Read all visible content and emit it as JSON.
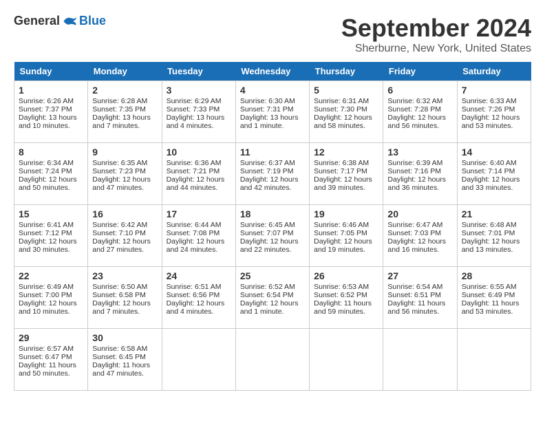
{
  "logo": {
    "general": "General",
    "blue": "Blue"
  },
  "title": "September 2024",
  "subtitle": "Sherburne, New York, United States",
  "days_of_week": [
    "Sunday",
    "Monday",
    "Tuesday",
    "Wednesday",
    "Thursday",
    "Friday",
    "Saturday"
  ],
  "weeks": [
    [
      {
        "day": "1",
        "info": "Sunrise: 6:26 AM\nSunset: 7:37 PM\nDaylight: 13 hours and 10 minutes."
      },
      {
        "day": "2",
        "info": "Sunrise: 6:28 AM\nSunset: 7:35 PM\nDaylight: 13 hours and 7 minutes."
      },
      {
        "day": "3",
        "info": "Sunrise: 6:29 AM\nSunset: 7:33 PM\nDaylight: 13 hours and 4 minutes."
      },
      {
        "day": "4",
        "info": "Sunrise: 6:30 AM\nSunset: 7:31 PM\nDaylight: 13 hours and 1 minute."
      },
      {
        "day": "5",
        "info": "Sunrise: 6:31 AM\nSunset: 7:30 PM\nDaylight: 12 hours and 58 minutes."
      },
      {
        "day": "6",
        "info": "Sunrise: 6:32 AM\nSunset: 7:28 PM\nDaylight: 12 hours and 56 minutes."
      },
      {
        "day": "7",
        "info": "Sunrise: 6:33 AM\nSunset: 7:26 PM\nDaylight: 12 hours and 53 minutes."
      }
    ],
    [
      {
        "day": "8",
        "info": "Sunrise: 6:34 AM\nSunset: 7:24 PM\nDaylight: 12 hours and 50 minutes."
      },
      {
        "day": "9",
        "info": "Sunrise: 6:35 AM\nSunset: 7:23 PM\nDaylight: 12 hours and 47 minutes."
      },
      {
        "day": "10",
        "info": "Sunrise: 6:36 AM\nSunset: 7:21 PM\nDaylight: 12 hours and 44 minutes."
      },
      {
        "day": "11",
        "info": "Sunrise: 6:37 AM\nSunset: 7:19 PM\nDaylight: 12 hours and 42 minutes."
      },
      {
        "day": "12",
        "info": "Sunrise: 6:38 AM\nSunset: 7:17 PM\nDaylight: 12 hours and 39 minutes."
      },
      {
        "day": "13",
        "info": "Sunrise: 6:39 AM\nSunset: 7:16 PM\nDaylight: 12 hours and 36 minutes."
      },
      {
        "day": "14",
        "info": "Sunrise: 6:40 AM\nSunset: 7:14 PM\nDaylight: 12 hours and 33 minutes."
      }
    ],
    [
      {
        "day": "15",
        "info": "Sunrise: 6:41 AM\nSunset: 7:12 PM\nDaylight: 12 hours and 30 minutes."
      },
      {
        "day": "16",
        "info": "Sunrise: 6:42 AM\nSunset: 7:10 PM\nDaylight: 12 hours and 27 minutes."
      },
      {
        "day": "17",
        "info": "Sunrise: 6:44 AM\nSunset: 7:08 PM\nDaylight: 12 hours and 24 minutes."
      },
      {
        "day": "18",
        "info": "Sunrise: 6:45 AM\nSunset: 7:07 PM\nDaylight: 12 hours and 22 minutes."
      },
      {
        "day": "19",
        "info": "Sunrise: 6:46 AM\nSunset: 7:05 PM\nDaylight: 12 hours and 19 minutes."
      },
      {
        "day": "20",
        "info": "Sunrise: 6:47 AM\nSunset: 7:03 PM\nDaylight: 12 hours and 16 minutes."
      },
      {
        "day": "21",
        "info": "Sunrise: 6:48 AM\nSunset: 7:01 PM\nDaylight: 12 hours and 13 minutes."
      }
    ],
    [
      {
        "day": "22",
        "info": "Sunrise: 6:49 AM\nSunset: 7:00 PM\nDaylight: 12 hours and 10 minutes."
      },
      {
        "day": "23",
        "info": "Sunrise: 6:50 AM\nSunset: 6:58 PM\nDaylight: 12 hours and 7 minutes."
      },
      {
        "day": "24",
        "info": "Sunrise: 6:51 AM\nSunset: 6:56 PM\nDaylight: 12 hours and 4 minutes."
      },
      {
        "day": "25",
        "info": "Sunrise: 6:52 AM\nSunset: 6:54 PM\nDaylight: 12 hours and 1 minute."
      },
      {
        "day": "26",
        "info": "Sunrise: 6:53 AM\nSunset: 6:52 PM\nDaylight: 11 hours and 59 minutes."
      },
      {
        "day": "27",
        "info": "Sunrise: 6:54 AM\nSunset: 6:51 PM\nDaylight: 11 hours and 56 minutes."
      },
      {
        "day": "28",
        "info": "Sunrise: 6:55 AM\nSunset: 6:49 PM\nDaylight: 11 hours and 53 minutes."
      }
    ],
    [
      {
        "day": "29",
        "info": "Sunrise: 6:57 AM\nSunset: 6:47 PM\nDaylight: 11 hours and 50 minutes."
      },
      {
        "day": "30",
        "info": "Sunrise: 6:58 AM\nSunset: 6:45 PM\nDaylight: 11 hours and 47 minutes."
      },
      {
        "day": "",
        "info": ""
      },
      {
        "day": "",
        "info": ""
      },
      {
        "day": "",
        "info": ""
      },
      {
        "day": "",
        "info": ""
      },
      {
        "day": "",
        "info": ""
      }
    ]
  ]
}
